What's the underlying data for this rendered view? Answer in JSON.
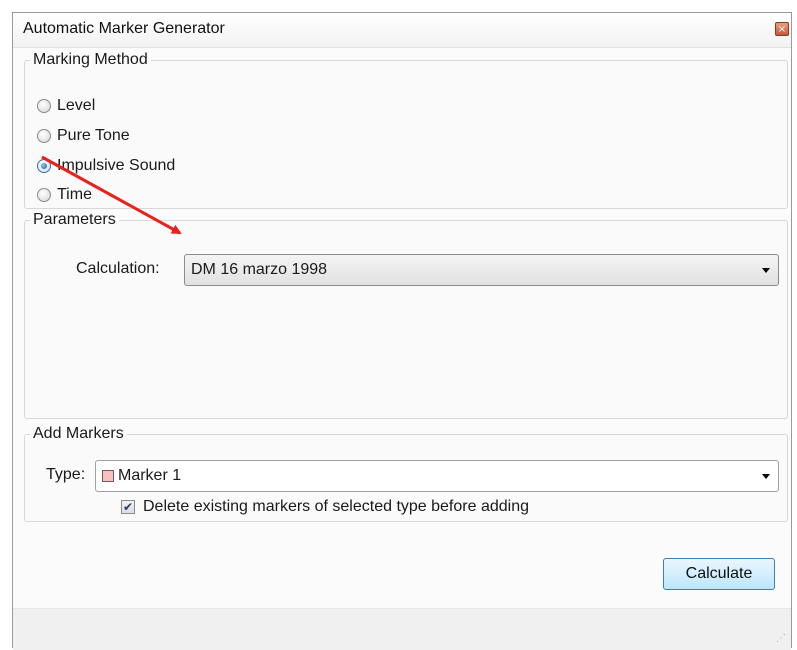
{
  "window": {
    "title": "Automatic Marker Generator",
    "close_icon": "close-icon",
    "close_glyph": "×"
  },
  "marking_method": {
    "legend": "Marking Method",
    "options": [
      {
        "label": "Level",
        "checked": false
      },
      {
        "label": "Pure Tone",
        "checked": false
      },
      {
        "label": "Impulsive Sound",
        "checked": true
      },
      {
        "label": "Time",
        "checked": false
      }
    ]
  },
  "parameters": {
    "legend": "Parameters",
    "calculation_label": "Calculation:",
    "calculation_value": "DM 16 marzo 1998"
  },
  "add_markers": {
    "legend": "Add Markers",
    "type_label": "Type:",
    "type_value": "Marker 1",
    "type_swatch_color": "#f6c1c1",
    "delete_existing_label": "Delete existing markers of selected type before adding",
    "delete_existing_checked": true,
    "check_glyph": "✔"
  },
  "actions": {
    "calculate_label": "Calculate"
  },
  "annotation": {
    "arrow_color": "#e8211c"
  },
  "colors": {
    "button_border": "#3c7fb1",
    "radio_selected": "#1f5ea8"
  }
}
